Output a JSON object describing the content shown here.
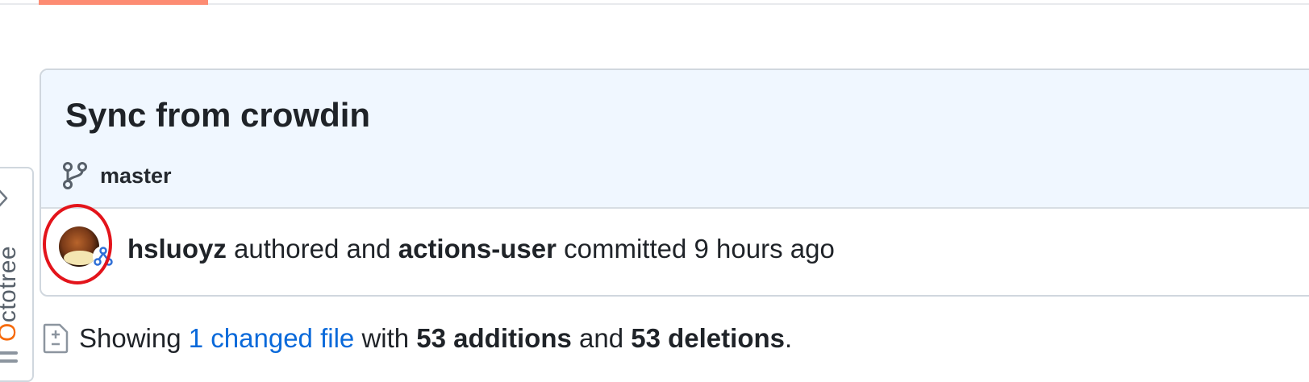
{
  "nav": {
    "accent_color": "#fd8c73"
  },
  "octotree": {
    "label_first": "O",
    "label_rest": "ctotree",
    "icon_chevron": "chevron-right-icon",
    "icon_handle": "drag-handle-icon"
  },
  "commit": {
    "title": "Sync from crowdin",
    "branch": "master",
    "author": "hsluoy z",
    "authored_word": "authored and",
    "committer": "actions-user",
    "committed_word": "committed",
    "time": "9 hours ago",
    "avatar_icon": "avatar",
    "highlight_color": "#e3141b"
  },
  "summary": {
    "showing": "Showing",
    "changed_files_link": "1 changed file",
    "with": "with",
    "additions": "53 additions",
    "and": "and",
    "deletions": "53 deletions",
    "period": "."
  }
}
